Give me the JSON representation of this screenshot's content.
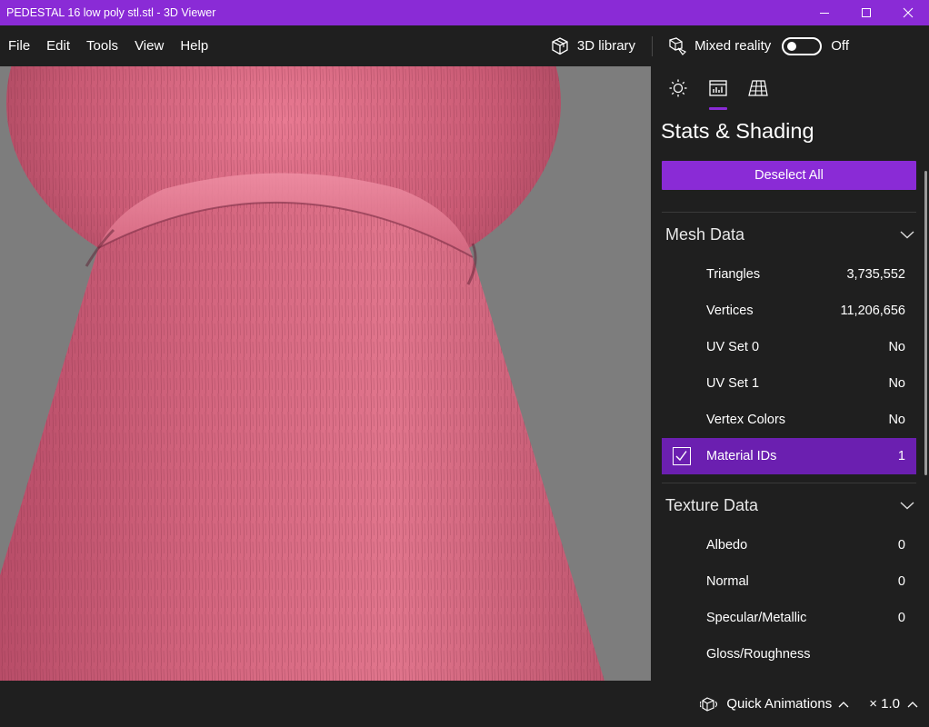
{
  "window": {
    "title": "PEDESTAL 16 low poly stl.stl - 3D Viewer",
    "title_bar_color": "#8a2bd6"
  },
  "menu": {
    "items": [
      "File",
      "Edit",
      "Tools",
      "View",
      "Help"
    ],
    "library_label": "3D library",
    "mixed_reality_label": "Mixed reality",
    "toggle_state": "Off"
  },
  "viewport": {
    "background": "#7d7d7d",
    "model_color": "#d9627f"
  },
  "panel": {
    "tabs": [
      {
        "icon": "sun-icon",
        "active": false
      },
      {
        "icon": "stats-icon",
        "active": true
      },
      {
        "icon": "grid-icon",
        "active": false
      }
    ],
    "title": "Stats & Shading",
    "deselect_label": "Deselect All",
    "mesh_section": {
      "label": "Mesh Data",
      "rows": [
        {
          "label": "Triangles",
          "value": "3,735,552"
        },
        {
          "label": "Vertices",
          "value": "11,206,656"
        },
        {
          "label": "UV Set 0",
          "value": "No"
        },
        {
          "label": "UV Set 1",
          "value": "No"
        },
        {
          "label": "Vertex Colors",
          "value": "No"
        },
        {
          "label": "Material IDs",
          "value": "1",
          "selected": true
        }
      ]
    },
    "texture_section": {
      "label": "Texture Data",
      "rows": [
        {
          "label": "Albedo",
          "value": "0"
        },
        {
          "label": "Normal",
          "value": "0"
        },
        {
          "label": "Specular/Metallic",
          "value": "0"
        },
        {
          "label": "Gloss/Roughness",
          "value": ""
        }
      ]
    }
  },
  "status": {
    "quick_animations_label": "Quick Animations",
    "speed_label": "× 1.0"
  }
}
